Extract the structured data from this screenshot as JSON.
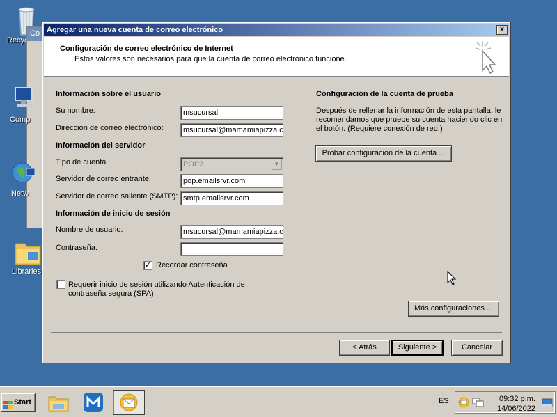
{
  "desktop": {
    "icons": [
      {
        "label": "Recycle Bin",
        "icon": "recycle-bin-icon"
      },
      {
        "label": "Computer",
        "icon": "computer-icon"
      },
      {
        "label": "Network",
        "icon": "network-icon"
      },
      {
        "label": "Libraries",
        "icon": "libraries-icon"
      }
    ],
    "visible_labels": [
      "Recyc",
      "Comp",
      "Netw",
      "Libraries"
    ],
    "bg_window_title": "Co"
  },
  "dialog": {
    "title": "Agregar una nueva cuenta de correo electrónico",
    "close_label": "x",
    "header": {
      "title": "Configuración de correo electrónico de Internet",
      "subtitle": "Estos valores son necesarios para que la cuenta de correo electrónico funcione."
    },
    "user_info": {
      "section": "Información sobre el usuario",
      "name_label": "Su nombre:",
      "name_value": "msucursal",
      "email_label": "Dirección de correo electrónico:",
      "email_value": "msucursal@mamamiapizza.com"
    },
    "server_info": {
      "section": "Información del servidor",
      "account_type_label": "Tipo de cuenta",
      "account_type_value": "POP3",
      "incoming_label": "Servidor de correo entrante:",
      "incoming_value": "pop.emailsrvr.com",
      "outgoing_label": "Servidor de correo saliente (SMTP):",
      "outgoing_value": "smtp.emailsrvr.com"
    },
    "logon_info": {
      "section": "Información de inicio de sesión",
      "username_label": "Nombre de usuario:",
      "username_value": "msucursal@mamamiapizza.com",
      "password_label": "Contraseña:",
      "password_value": "",
      "remember_label": "Recordar contraseña",
      "remember_checked": true,
      "spa_label_line1": "Requerir inicio de sesión utilizando Autenticación de",
      "spa_label_line2": "contraseña segura (SPA)",
      "spa_checked": false
    },
    "test_settings": {
      "section": "Configuración de la cuenta de prueba",
      "desc_line1": "Después de rellenar la información de esta pantalla, le",
      "desc_line2": "recomendamos que pruebe su cuenta haciendo clic en",
      "desc_line3": "el botón. (Requiere conexión de red.)",
      "test_button": "Probar configuración de la cuenta ..."
    },
    "more_settings_button": "Más configuraciones ...",
    "back_button": "< Atrás",
    "next_button": "Siguiente >",
    "cancel_button": "Cancelar"
  },
  "taskbar": {
    "start_label": "Start",
    "apps": [
      "file-explorer-icon",
      "maxthon-browser-icon",
      "outlook-icon"
    ],
    "language": "ES",
    "time": "09:32 p.m.",
    "date": "14/06/2022"
  }
}
